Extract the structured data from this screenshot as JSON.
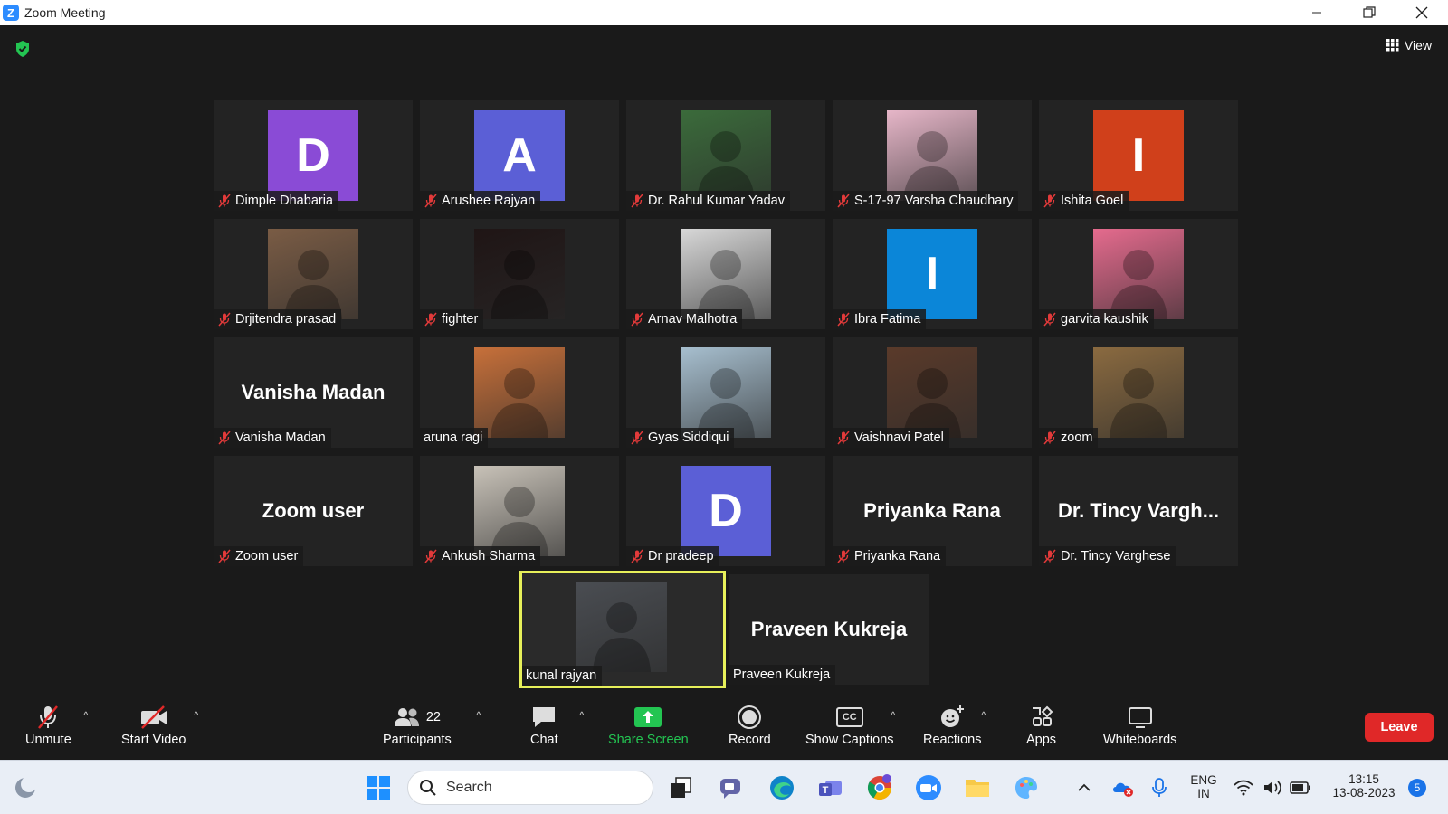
{
  "window": {
    "title": "Zoom Meeting"
  },
  "header": {
    "view_label": "View"
  },
  "participants": [
    {
      "name": "Dimple Dhabaria",
      "avatar": "letter",
      "letter": "D",
      "color": "#8a4bd6",
      "muted": true
    },
    {
      "name": "Arushee Rajyan",
      "avatar": "letter",
      "letter": "A",
      "color": "#5b5fd6",
      "muted": true
    },
    {
      "name": "Dr. Rahul Kumar Yadav",
      "avatar": "photo",
      "color": "#3b6b3b",
      "muted": true
    },
    {
      "name": "S-17-97 Varsha Chaudhary",
      "avatar": "photo",
      "color": "#e6b6c8",
      "muted": true
    },
    {
      "name": "Ishita Goel",
      "avatar": "letter",
      "letter": "I",
      "color": "#d0401b",
      "muted": true
    },
    {
      "name": "Drjitendra prasad",
      "avatar": "photo",
      "color": "#7a5c45",
      "muted": true
    },
    {
      "name": "fighter",
      "avatar": "photo",
      "color": "#1f1515",
      "muted": true
    },
    {
      "name": "Arnav Malhotra",
      "avatar": "photo",
      "color": "#d8d8d8",
      "muted": true
    },
    {
      "name": "Ibra Fatima",
      "avatar": "letter",
      "letter": "I",
      "color": "#0b86d8",
      "muted": true
    },
    {
      "name": "garvita kaushik",
      "avatar": "photo",
      "color": "#e56b8e",
      "muted": true
    },
    {
      "name": "Vanisha Madan",
      "avatar": "name",
      "muted": true
    },
    {
      "name": "aruna ragi",
      "avatar": "photo",
      "color": "#c7703a",
      "muted": false
    },
    {
      "name": "Gyas Siddiqui",
      "avatar": "photo",
      "color": "#a7bfcf",
      "muted": true
    },
    {
      "name": "Vaishnavi Patel",
      "avatar": "photo",
      "color": "#5a3a2a",
      "muted": true
    },
    {
      "name": "zoom",
      "avatar": "photo",
      "color": "#8a6a40",
      "muted": true
    },
    {
      "name": "Zoom user",
      "avatar": "name",
      "muted": true
    },
    {
      "name": "Ankush Sharma",
      "avatar": "photo",
      "color": "#c8c2b8",
      "muted": true
    },
    {
      "name": "Dr pradeep",
      "avatar": "letter",
      "letter": "D",
      "color": "#5b5fd6",
      "muted": true
    },
    {
      "name": "Priyanka Rana",
      "avatar": "name",
      "muted": true
    },
    {
      "name": "Dr. Tincy Varghese",
      "avatar": "name",
      "display": "Dr. Tincy Vargh...",
      "muted": true
    },
    {
      "name": "kunal rajyan",
      "avatar": "photo",
      "color": "#4a4d52",
      "muted": false,
      "active": true
    },
    {
      "name": "Praveen Kukreja",
      "avatar": "name",
      "muted": false
    }
  ],
  "toolbar": {
    "unmute": "Unmute",
    "start_video": "Start Video",
    "participants": "Participants",
    "participants_count": "22",
    "chat": "Chat",
    "share_screen": "Share Screen",
    "record": "Record",
    "show_captions": "Show Captions",
    "captions_icon_text": "CC",
    "reactions": "Reactions",
    "apps": "Apps",
    "whiteboards": "Whiteboards",
    "leave": "Leave"
  },
  "taskbar": {
    "search_placeholder": "Search",
    "lang_top": "ENG",
    "lang_bottom": "IN",
    "time": "13:15",
    "date": "13-08-2023",
    "notifications": "5"
  },
  "colors": {
    "share_green": "#23c552",
    "leave_red": "#e02828",
    "active_border": "#e7f05a"
  }
}
